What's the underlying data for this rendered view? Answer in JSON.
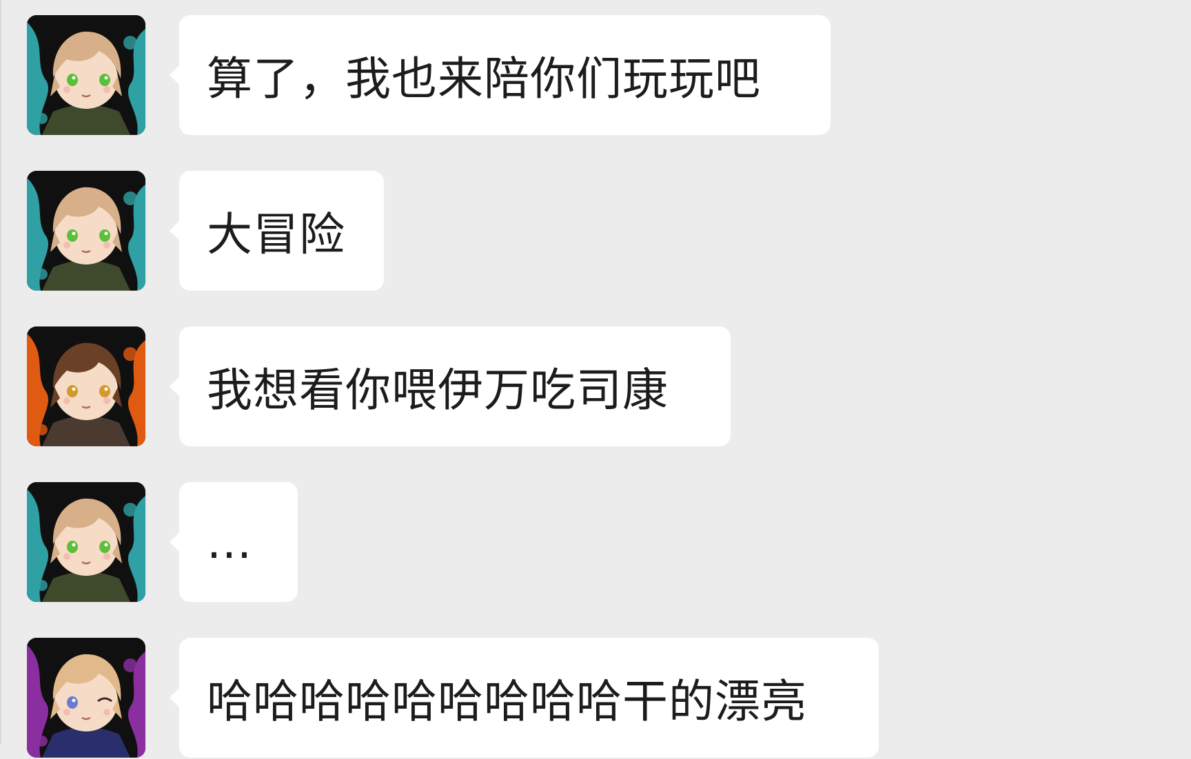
{
  "messages": [
    {
      "avatar": "avatar-green-eyed-character",
      "text": "算了，我也来陪你们玩玩吧",
      "colors": {
        "accent": "#2fa0a3",
        "hair": "#d7b08a",
        "eyes": "#5cbf3a",
        "coat": "#3f4a2c"
      }
    },
    {
      "avatar": "avatar-green-eyed-character",
      "text": "大冒险",
      "colors": {
        "accent": "#2fa0a3",
        "hair": "#d7b08a",
        "eyes": "#5cbf3a",
        "coat": "#3f4a2c"
      }
    },
    {
      "avatar": "avatar-brown-haired-character",
      "text": "我想看你喂伊万吃司康",
      "colors": {
        "accent": "#e05a12",
        "hair": "#6a4026",
        "eyes": "#d29a2a",
        "coat": "#4b3a30"
      }
    },
    {
      "avatar": "avatar-green-eyed-character",
      "text": "...",
      "colors": {
        "accent": "#2fa0a3",
        "hair": "#d7b08a",
        "eyes": "#5cbf3a",
        "coat": "#3f4a2c"
      }
    },
    {
      "avatar": "avatar-blonde-winking-character",
      "text": "哈哈哈哈哈哈哈哈哈干的漂亮",
      "colors": {
        "accent": "#8b2fa0",
        "hair": "#e2b98a",
        "eyes": "#6a7bd0",
        "coat": "#2a2e6b"
      }
    }
  ]
}
